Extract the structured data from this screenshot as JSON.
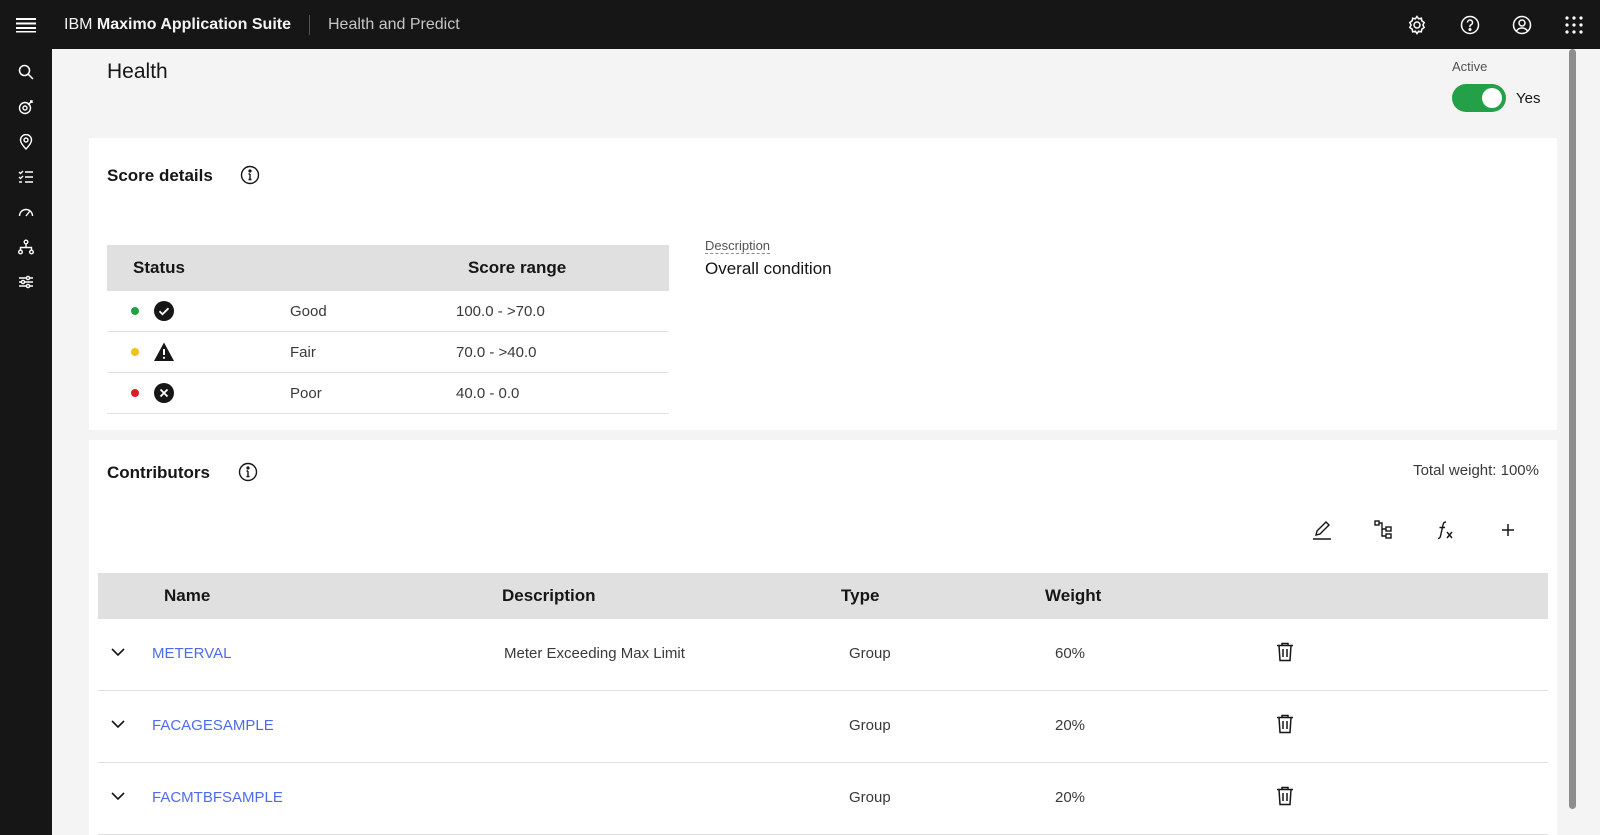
{
  "header": {
    "brand_prefix": "IBM",
    "brand_name": "Maximo Application Suite",
    "app_name": "Health and Predict"
  },
  "page": {
    "title": "Health",
    "active_label": "Active",
    "active_value": "Yes"
  },
  "score_details": {
    "title": "Score details",
    "col_status": "Status",
    "col_range": "Score range",
    "rows": [
      {
        "status": "Good",
        "range": "100.0 - >70.0",
        "color": "#24a148",
        "icon": "checkmark-filled-icon"
      },
      {
        "status": "Fair",
        "range": "70.0 - >40.0",
        "color": "#f1c21b",
        "icon": "warning-filled-icon"
      },
      {
        "status": "Poor",
        "range": "40.0 - 0.0",
        "color": "#da1e28",
        "icon": "error-filled-icon"
      }
    ],
    "description_label": "Description",
    "description_value": "Overall condition"
  },
  "contributors": {
    "title": "Contributors",
    "total_weight": "Total weight: 100%",
    "columns": {
      "name": "Name",
      "description": "Description",
      "type": "Type",
      "weight": "Weight"
    },
    "rows": [
      {
        "name": "METERVAL",
        "description": "Meter Exceeding Max Limit",
        "type": "Group",
        "weight": "60%"
      },
      {
        "name": "FACAGESAMPLE",
        "description": "",
        "type": "Group",
        "weight": "20%"
      },
      {
        "name": "FACMTBFSAMPLE",
        "description": "",
        "type": "Group",
        "weight": "20%"
      }
    ]
  }
}
